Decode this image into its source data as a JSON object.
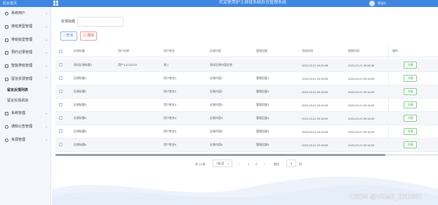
{
  "header": {
    "home_label": "后台首页",
    "title": "欢迎使用护士排班系统后台管理系统",
    "username": "管理员"
  },
  "sidebar": {
    "items": [
      {
        "label": "系统用户",
        "icon": "user-icon"
      },
      {
        "label": "排班类型管理",
        "icon": "file-icon"
      },
      {
        "label": "排班班型管理",
        "icon": "file-icon"
      },
      {
        "label": "预约记录管理",
        "icon": "file-icon"
      },
      {
        "label": "智能排班管理",
        "icon": "file-icon"
      },
      {
        "label": "留言反馈管理",
        "icon": "file-icon"
      }
    ],
    "subitems": [
      {
        "label": "留言反馈列表",
        "active": true
      },
      {
        "label": "留言反馈添加",
        "active": false
      }
    ],
    "items_after": [
      {
        "label": "系统管理",
        "icon": "grid-icon"
      },
      {
        "label": "通知公告管理",
        "icon": "info-icon"
      },
      {
        "label": "资源管理",
        "icon": "info-icon"
      }
    ]
  },
  "search": {
    "label": "反馈标题",
    "value": "",
    "search_button": "查询",
    "delete_button": "删除"
  },
  "table": {
    "columns": [
      "反馈标题",
      "用户名称",
      "用户姓名",
      "反馈内容",
      "管理回复",
      "添加时间",
      "更新时间",
      "操作"
    ],
    "rows": [
      {
        "title": "测试反馈标题1",
        "user_name": "用户1-1122233",
        "real_name": "张三",
        "content": "测试反馈内容信息",
        "reply": "",
        "created": "2024-03-21 09:26:38",
        "updated": "2024-03-21 09:26:38",
        "action": "详情"
      },
      {
        "title": "反馈标题1",
        "user_name": "",
        "real_name": "用户姓名1",
        "content": "反馈内容1",
        "reply": "管理回复1",
        "created": "2024-03-21 09:18:09",
        "updated": "2024-03-21 09:18:09",
        "action": "详情"
      },
      {
        "title": "反馈标题2",
        "user_name": "",
        "real_name": "用户姓名2",
        "content": "反馈内容2",
        "reply": "管理回复2",
        "created": "2024-03-21 09:18:09",
        "updated": "2024-03-21 09:18:09",
        "action": "详情"
      },
      {
        "title": "反馈标题3",
        "user_name": "",
        "real_name": "用户姓名3",
        "content": "反馈内容3",
        "reply": "管理回复3",
        "created": "2024-03-21 09:18:09",
        "updated": "2024-03-21 09:18:09",
        "action": "详情"
      },
      {
        "title": "反馈标题4",
        "user_name": "",
        "real_name": "用户姓名4",
        "content": "反馈内容4",
        "reply": "管理回复4",
        "created": "2024-03-21 09:18:09",
        "updated": "2024-03-21 09:18:09",
        "action": "详情"
      },
      {
        "title": "反馈标题5",
        "user_name": "",
        "real_name": "用户姓名5",
        "content": "反馈内容5",
        "reply": "管理回复5",
        "created": "2024-03-21 09:18:09",
        "updated": "2024-03-21 09:18:09",
        "action": "详情"
      },
      {
        "title": "反馈标题6",
        "user_name": "",
        "real_name": "用户姓名6",
        "content": "反馈内容6",
        "reply": "管理回复6",
        "created": "2024-03-21 09:18:09",
        "updated": "2024-03-21 09:18:09",
        "action": "详情"
      }
    ]
  },
  "pagination": {
    "total": "共 13 条",
    "page_size": "7条/页",
    "prev": "‹",
    "pages": [
      "1",
      "2"
    ],
    "current_page": "2",
    "next": "›",
    "goto_label": "前往",
    "goto_value": "1",
    "goto_suffix": "页"
  },
  "watermark": "CSDN @VXMZ_ZXD001",
  "colors": {
    "header_blue": "#3f86e0",
    "sidebar_bg": "#f3f6fb",
    "detail_green": "#4caf50",
    "delete_red": "#e05555"
  }
}
